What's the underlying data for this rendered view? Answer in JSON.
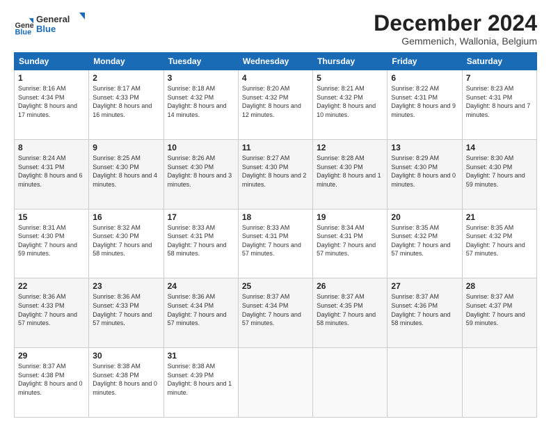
{
  "logo": {
    "line1": "General",
    "line2": "Blue"
  },
  "title": "December 2024",
  "subtitle": "Gemmenich, Wallonia, Belgium",
  "days_of_week": [
    "Sunday",
    "Monday",
    "Tuesday",
    "Wednesday",
    "Thursday",
    "Friday",
    "Saturday"
  ],
  "weeks": [
    [
      {
        "day": "1",
        "info": "Sunrise: 8:16 AM\nSunset: 4:34 PM\nDaylight: 8 hours and 17 minutes."
      },
      {
        "day": "2",
        "info": "Sunrise: 8:17 AM\nSunset: 4:33 PM\nDaylight: 8 hours and 16 minutes."
      },
      {
        "day": "3",
        "info": "Sunrise: 8:18 AM\nSunset: 4:32 PM\nDaylight: 8 hours and 14 minutes."
      },
      {
        "day": "4",
        "info": "Sunrise: 8:20 AM\nSunset: 4:32 PM\nDaylight: 8 hours and 12 minutes."
      },
      {
        "day": "5",
        "info": "Sunrise: 8:21 AM\nSunset: 4:32 PM\nDaylight: 8 hours and 10 minutes."
      },
      {
        "day": "6",
        "info": "Sunrise: 8:22 AM\nSunset: 4:31 PM\nDaylight: 8 hours and 9 minutes."
      },
      {
        "day": "7",
        "info": "Sunrise: 8:23 AM\nSunset: 4:31 PM\nDaylight: 8 hours and 7 minutes."
      }
    ],
    [
      {
        "day": "8",
        "info": "Sunrise: 8:24 AM\nSunset: 4:31 PM\nDaylight: 8 hours and 6 minutes."
      },
      {
        "day": "9",
        "info": "Sunrise: 8:25 AM\nSunset: 4:30 PM\nDaylight: 8 hours and 4 minutes."
      },
      {
        "day": "10",
        "info": "Sunrise: 8:26 AM\nSunset: 4:30 PM\nDaylight: 8 hours and 3 minutes."
      },
      {
        "day": "11",
        "info": "Sunrise: 8:27 AM\nSunset: 4:30 PM\nDaylight: 8 hours and 2 minutes."
      },
      {
        "day": "12",
        "info": "Sunrise: 8:28 AM\nSunset: 4:30 PM\nDaylight: 8 hours and 1 minute."
      },
      {
        "day": "13",
        "info": "Sunrise: 8:29 AM\nSunset: 4:30 PM\nDaylight: 8 hours and 0 minutes."
      },
      {
        "day": "14",
        "info": "Sunrise: 8:30 AM\nSunset: 4:30 PM\nDaylight: 7 hours and 59 minutes."
      }
    ],
    [
      {
        "day": "15",
        "info": "Sunrise: 8:31 AM\nSunset: 4:30 PM\nDaylight: 7 hours and 59 minutes."
      },
      {
        "day": "16",
        "info": "Sunrise: 8:32 AM\nSunset: 4:30 PM\nDaylight: 7 hours and 58 minutes."
      },
      {
        "day": "17",
        "info": "Sunrise: 8:33 AM\nSunset: 4:31 PM\nDaylight: 7 hours and 58 minutes."
      },
      {
        "day": "18",
        "info": "Sunrise: 8:33 AM\nSunset: 4:31 PM\nDaylight: 7 hours and 57 minutes."
      },
      {
        "day": "19",
        "info": "Sunrise: 8:34 AM\nSunset: 4:31 PM\nDaylight: 7 hours and 57 minutes."
      },
      {
        "day": "20",
        "info": "Sunrise: 8:35 AM\nSunset: 4:32 PM\nDaylight: 7 hours and 57 minutes."
      },
      {
        "day": "21",
        "info": "Sunrise: 8:35 AM\nSunset: 4:32 PM\nDaylight: 7 hours and 57 minutes."
      }
    ],
    [
      {
        "day": "22",
        "info": "Sunrise: 8:36 AM\nSunset: 4:33 PM\nDaylight: 7 hours and 57 minutes."
      },
      {
        "day": "23",
        "info": "Sunrise: 8:36 AM\nSunset: 4:33 PM\nDaylight: 7 hours and 57 minutes."
      },
      {
        "day": "24",
        "info": "Sunrise: 8:36 AM\nSunset: 4:34 PM\nDaylight: 7 hours and 57 minutes."
      },
      {
        "day": "25",
        "info": "Sunrise: 8:37 AM\nSunset: 4:34 PM\nDaylight: 7 hours and 57 minutes."
      },
      {
        "day": "26",
        "info": "Sunrise: 8:37 AM\nSunset: 4:35 PM\nDaylight: 7 hours and 58 minutes."
      },
      {
        "day": "27",
        "info": "Sunrise: 8:37 AM\nSunset: 4:36 PM\nDaylight: 7 hours and 58 minutes."
      },
      {
        "day": "28",
        "info": "Sunrise: 8:37 AM\nSunset: 4:37 PM\nDaylight: 7 hours and 59 minutes."
      }
    ],
    [
      {
        "day": "29",
        "info": "Sunrise: 8:37 AM\nSunset: 4:38 PM\nDaylight: 8 hours and 0 minutes."
      },
      {
        "day": "30",
        "info": "Sunrise: 8:38 AM\nSunset: 4:38 PM\nDaylight: 8 hours and 0 minutes."
      },
      {
        "day": "31",
        "info": "Sunrise: 8:38 AM\nSunset: 4:39 PM\nDaylight: 8 hours and 1 minute."
      },
      null,
      null,
      null,
      null
    ]
  ]
}
